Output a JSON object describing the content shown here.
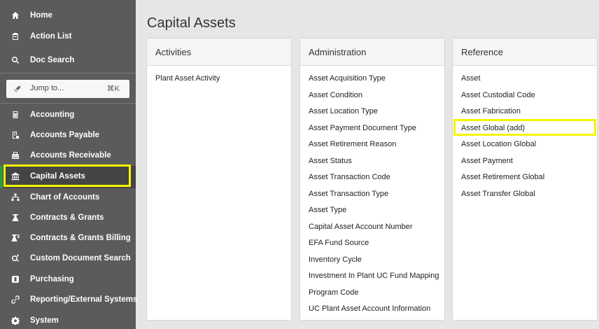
{
  "sidebar": {
    "items_top": [
      {
        "label": "Home",
        "icon": "home-icon"
      },
      {
        "label": "Action List",
        "icon": "clipboard-icon"
      },
      {
        "label": "Doc Search",
        "icon": "search-icon"
      }
    ],
    "jump": {
      "label": "Jump to...",
      "shortcut": "⌘K",
      "icon": "rocket-icon"
    },
    "items": [
      {
        "label": "Accounting",
        "icon": "calculator-icon"
      },
      {
        "label": "Accounts Payable",
        "icon": "invoice-icon"
      },
      {
        "label": "Accounts Receivable",
        "icon": "register-icon"
      },
      {
        "label": "Capital Assets",
        "icon": "bank-icon"
      },
      {
        "label": "Chart of Accounts",
        "icon": "sitemap-icon"
      },
      {
        "label": "Contracts & Grants",
        "icon": "flask-icon"
      },
      {
        "label": "Contracts & Grants Billing",
        "icon": "flask-billing-icon"
      },
      {
        "label": "Custom Document Search",
        "icon": "search-doc-icon"
      },
      {
        "label": "Purchasing",
        "icon": "cart-icon"
      },
      {
        "label": "Reporting/External Systems",
        "icon": "link-icon"
      },
      {
        "label": "System",
        "icon": "gear-icon"
      }
    ],
    "active_item": "Capital Assets",
    "accent_color": "#2f9a43",
    "highlight_color": "#f5f500"
  },
  "main": {
    "title": "Capital Assets",
    "cards": [
      {
        "title": "Activities",
        "links": [
          "Plant Asset Activity"
        ]
      },
      {
        "title": "Administration",
        "links": [
          "Asset Acquisition Type",
          "Asset Condition",
          "Asset Location Type",
          "Asset Payment Document Type",
          "Asset Retirement Reason",
          "Asset Status",
          "Asset Transaction Code",
          "Asset Transaction Type",
          "Asset Type",
          "Capital Asset Account Number",
          "EFA Fund Source",
          "Inventory Cycle",
          "Investment In Plant UC Fund Mapping",
          "Program Code",
          "UC Plant Asset Account Information"
        ]
      },
      {
        "title": "Reference",
        "links": [
          "Asset",
          "Asset Custodial Code",
          "Asset Fabrication",
          "Asset Global (add)",
          "Asset Location Global",
          "Asset Payment",
          "Asset Retirement Global",
          "Asset Transfer Global"
        ]
      }
    ]
  }
}
